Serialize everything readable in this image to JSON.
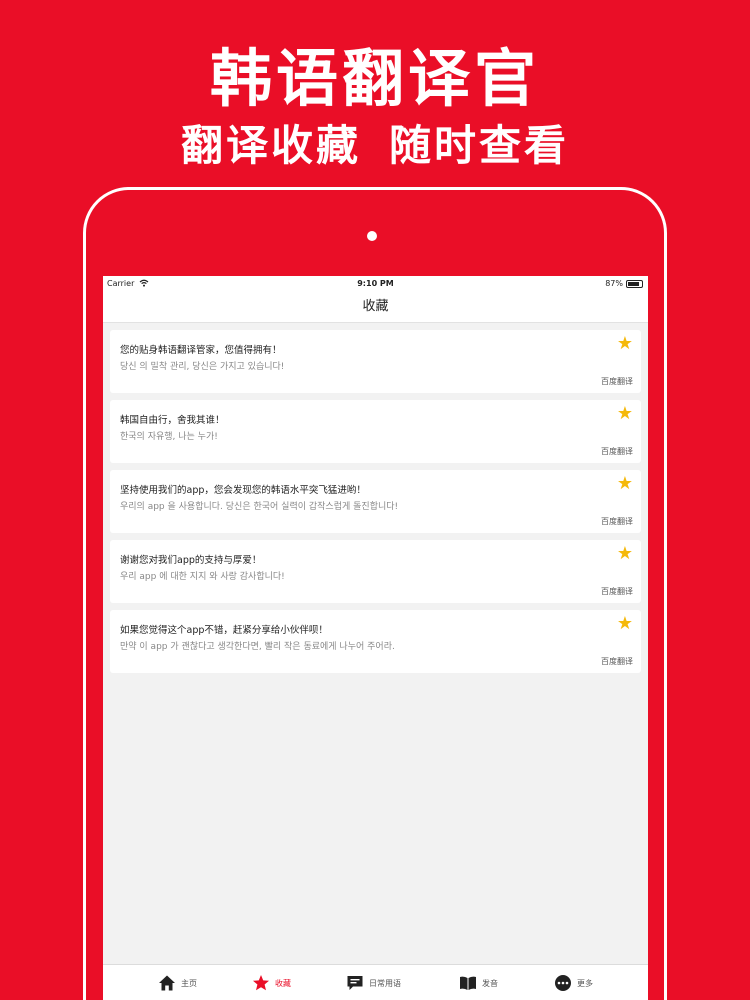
{
  "promo": {
    "title": "韩语翻译官",
    "subtitle_left": "翻译收藏",
    "subtitle_right": "随时查看"
  },
  "status_bar": {
    "carrier": "Carrier",
    "time": "9:10 PM",
    "battery": "87%",
    "battery_level": 0.87
  },
  "nav": {
    "title": "收藏"
  },
  "favorites": [
    {
      "zh": "您的贴身韩语翻译管家，您值得拥有！",
      "ko": "당신 의 밀착 관리, 당신은 가지고 있습니다!",
      "source": "百度翻译"
    },
    {
      "zh": "韩国自由行，舍我其谁！",
      "ko": "한국의 자유행, 나는 누가!",
      "source": "百度翻译"
    },
    {
      "zh": "坚持使用我们的app，您会发现您的韩语水平突飞猛进哟！",
      "ko": "우리의 app 을 사용합니다. 당신은 한국어 실력이 갑작스럽게 돌진합니다!",
      "source": "百度翻译"
    },
    {
      "zh": "谢谢您对我们app的支持与厚爱！",
      "ko": "우리 app 에 대한 지지 와 사랑 감사합니다!",
      "source": "百度翻译"
    },
    {
      "zh": "如果您觉得这个app不错，赶紧分享给小伙伴呗！",
      "ko": "만약 이 app 가 괜찮다고 생각한다면, 빨리 작은 동료에게 나누어 주어라.",
      "source": "百度翻译"
    }
  ],
  "tabs": [
    {
      "label": "主页",
      "icon": "home-icon",
      "active": false
    },
    {
      "label": "收藏",
      "icon": "star-icon",
      "active": true
    },
    {
      "label": "日常用语",
      "icon": "chat-icon",
      "active": false
    },
    {
      "label": "发音",
      "icon": "book-icon",
      "active": false
    },
    {
      "label": "更多",
      "icon": "more-icon",
      "active": false
    }
  ],
  "colors": {
    "brand_red": "#ea0e27",
    "star_yellow": "#f5b90c",
    "tab_inactive": "#222222"
  }
}
